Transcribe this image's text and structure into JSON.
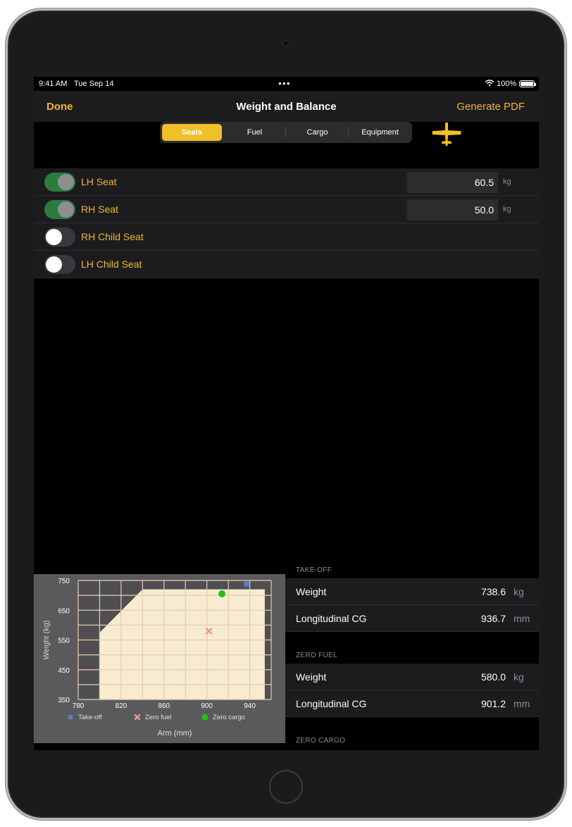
{
  "status_bar": {
    "time": "9:41 AM",
    "date": "Tue Sep 14",
    "battery": "100%",
    "dots": "•••"
  },
  "nav": {
    "done_label": "Done",
    "title": "Weight and Balance",
    "generate_label": "Generate PDF"
  },
  "tabs": [
    {
      "label": "Seats",
      "active": true
    },
    {
      "label": "Fuel",
      "active": false
    },
    {
      "label": "Cargo",
      "active": false
    },
    {
      "label": "Equipment",
      "active": false
    }
  ],
  "seats": [
    {
      "label": "LH Seat",
      "on": true,
      "value": "60.5",
      "unit": "kg"
    },
    {
      "label": "RH Seat",
      "on": true,
      "value": "50.0",
      "unit": "kg"
    },
    {
      "label": "RH Child Seat",
      "on": false
    },
    {
      "label": "LH Child Seat",
      "on": false
    }
  ],
  "results": {
    "takeoff": {
      "header": "TAKE-OFF",
      "weight_label": "Weight",
      "weight_value": "738.6",
      "weight_unit": "kg",
      "cg_label": "Longitudinal CG",
      "cg_value": "936.7",
      "cg_unit": "mm"
    },
    "zero_fuel": {
      "header": "ZERO FUEL",
      "weight_label": "Weight",
      "weight_value": "580.0",
      "weight_unit": "kg",
      "cg_label": "Longitudinal CG",
      "cg_value": "901.2",
      "cg_unit": "mm"
    },
    "zero_cargo": {
      "header": "ZERO CARGO"
    }
  },
  "colors": {
    "accent": "#f0b72f",
    "segment_active": "#f0bf2a",
    "toggle_on": "#2a7d3e",
    "envelope_fill": "#f7ecd0",
    "grid_line": "#e9c9b4",
    "takeoff_marker": "#5b7fc4",
    "zero_fuel_marker": "#e59a95",
    "zero_cargo_marker": "#1fc01f"
  },
  "chart_data": {
    "type": "scatter",
    "xlabel": "Arm (mm)",
    "ylabel": "Weight (kg)",
    "xlim": [
      780,
      960
    ],
    "ylim": [
      350,
      750
    ],
    "x_ticks": [
      780,
      820,
      860,
      900,
      940
    ],
    "y_ticks": [
      350,
      450,
      550,
      650,
      750
    ],
    "grid": true,
    "legend_placement": "bottom",
    "envelope": {
      "name": "",
      "points": [
        [
          800,
          350
        ],
        [
          800,
          575
        ],
        [
          840,
          720
        ],
        [
          954,
          720
        ],
        [
          954,
          350
        ]
      ]
    },
    "series": [
      {
        "name": "Take-off",
        "marker": "square",
        "x": [
          937
        ],
        "y": [
          738
        ]
      },
      {
        "name": "Zero fuel",
        "marker": "cross",
        "x": [
          902
        ],
        "y": [
          580
        ]
      },
      {
        "name": "Zero cargo",
        "marker": "circle",
        "x": [
          914
        ],
        "y": [
          705
        ]
      }
    ]
  }
}
